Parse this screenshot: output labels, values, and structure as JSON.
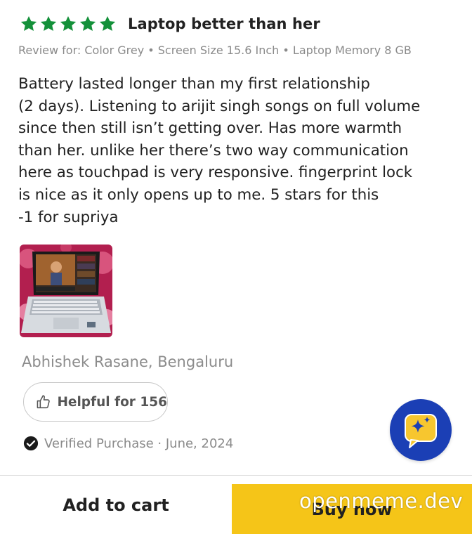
{
  "review": {
    "rating": 5,
    "rating_max": 5,
    "star_color": "#14913a",
    "title": "Laptop better than her",
    "variant": "Review for: Color Grey • Screen Size 15.6 Inch • Laptop Memory 8 GB",
    "body_lines": [
      "Battery lasted longer than my first relationship",
      "(2 days). Listening to arijit singh songs on full volume",
      "since then still isn’t getting over. Has more warmth",
      "than her. unlike her there’s two way communication",
      "here as touchpad is very responsive. fingerprint lock",
      "is nice as it only opens up to me. 5 stars for this",
      "-1 for supriya"
    ],
    "photo_icon": "laptop-photo",
    "reviewer": "Abhishek Rasane, Bengaluru",
    "helpful_label": "Helpful for 156",
    "verified_label": "Verified Purchase · June, 2024"
  },
  "assistant": {
    "icon": "sparkle-chat-icon",
    "color": "#1b3fb5"
  },
  "actions": {
    "add_to_cart_label": "Add to cart",
    "buy_now_label": "Buy now",
    "buy_now_color": "#f5c518"
  },
  "watermark": "openmeme.dev"
}
